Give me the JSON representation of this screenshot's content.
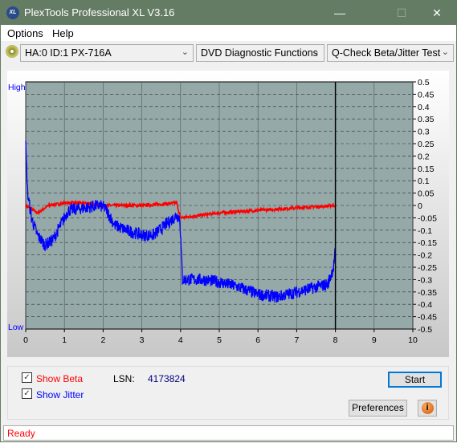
{
  "window": {
    "title": "PlexTools Professional XL V3.16",
    "logo": "XL"
  },
  "menu": [
    {
      "label": "Options"
    },
    {
      "label": "Help"
    }
  ],
  "toolbar": {
    "drive": "HA:0 ID:1  PX-716A",
    "function": "DVD Diagnostic Functions",
    "test": "Q-Check Beta/Jitter Test"
  },
  "chart_data": {
    "type": "line",
    "left_axis_labels": {
      "high": "High",
      "low": "Low"
    },
    "xlim": [
      0,
      10
    ],
    "ylim": [
      -0.5,
      0.5
    ],
    "x_ticks": [
      "0",
      "1",
      "2",
      "3",
      "4",
      "5",
      "6",
      "7",
      "8",
      "9",
      "10"
    ],
    "y_ticks": [
      "0.5",
      "0.45",
      "0.4",
      "0.35",
      "0.3",
      "0.25",
      "0.2",
      "0.15",
      "0.1",
      "0.05",
      "0",
      "-0.05",
      "-0.1",
      "-0.15",
      "-0.2",
      "-0.25",
      "-0.3",
      "-0.35",
      "-0.4",
      "-0.45",
      "-0.5"
    ],
    "grid": true,
    "marker_x": 8,
    "series": [
      {
        "name": "Beta",
        "color": "#ff0000",
        "x": [
          0,
          0.3,
          0.6,
          1,
          1.5,
          2,
          2.5,
          3,
          3.5,
          3.9,
          4,
          4.5,
          5,
          5.5,
          6,
          6.5,
          7,
          7.5,
          8
        ],
        "y": [
          0,
          -0.03,
          0,
          0.01,
          0.01,
          0,
          0,
          0,
          0.005,
          0.01,
          -0.05,
          -0.04,
          -0.03,
          -0.025,
          -0.02,
          -0.015,
          -0.01,
          -0.005,
          0
        ]
      },
      {
        "name": "Jitter",
        "color": "#0000ff",
        "x": [
          0,
          0.05,
          0.15,
          0.3,
          0.5,
          0.7,
          0.9,
          1.1,
          1.5,
          1.9,
          2.05,
          2.3,
          2.6,
          3,
          3.3,
          3.6,
          3.9,
          3.98,
          4.05,
          4.3,
          4.6,
          5,
          5.5,
          6,
          6.5,
          7,
          7.5,
          7.8,
          7.95,
          8
        ],
        "y": [
          0.24,
          0.05,
          -0.05,
          -0.12,
          -0.16,
          -0.14,
          -0.08,
          -0.02,
          -0.01,
          0,
          -0.01,
          -0.08,
          -0.1,
          -0.12,
          -0.12,
          -0.08,
          -0.04,
          -0.05,
          -0.3,
          -0.3,
          -0.3,
          -0.31,
          -0.33,
          -0.36,
          -0.37,
          -0.35,
          -0.33,
          -0.32,
          -0.25,
          -0.18
        ]
      }
    ]
  },
  "controls": {
    "show_beta": "Show Beta",
    "show_jitter": "Show Jitter",
    "lsn_label": "LSN:",
    "lsn_value": "4173824",
    "start": "Start",
    "preferences": "Preferences",
    "beta_checked": true,
    "jitter_checked": true
  },
  "status": "Ready"
}
